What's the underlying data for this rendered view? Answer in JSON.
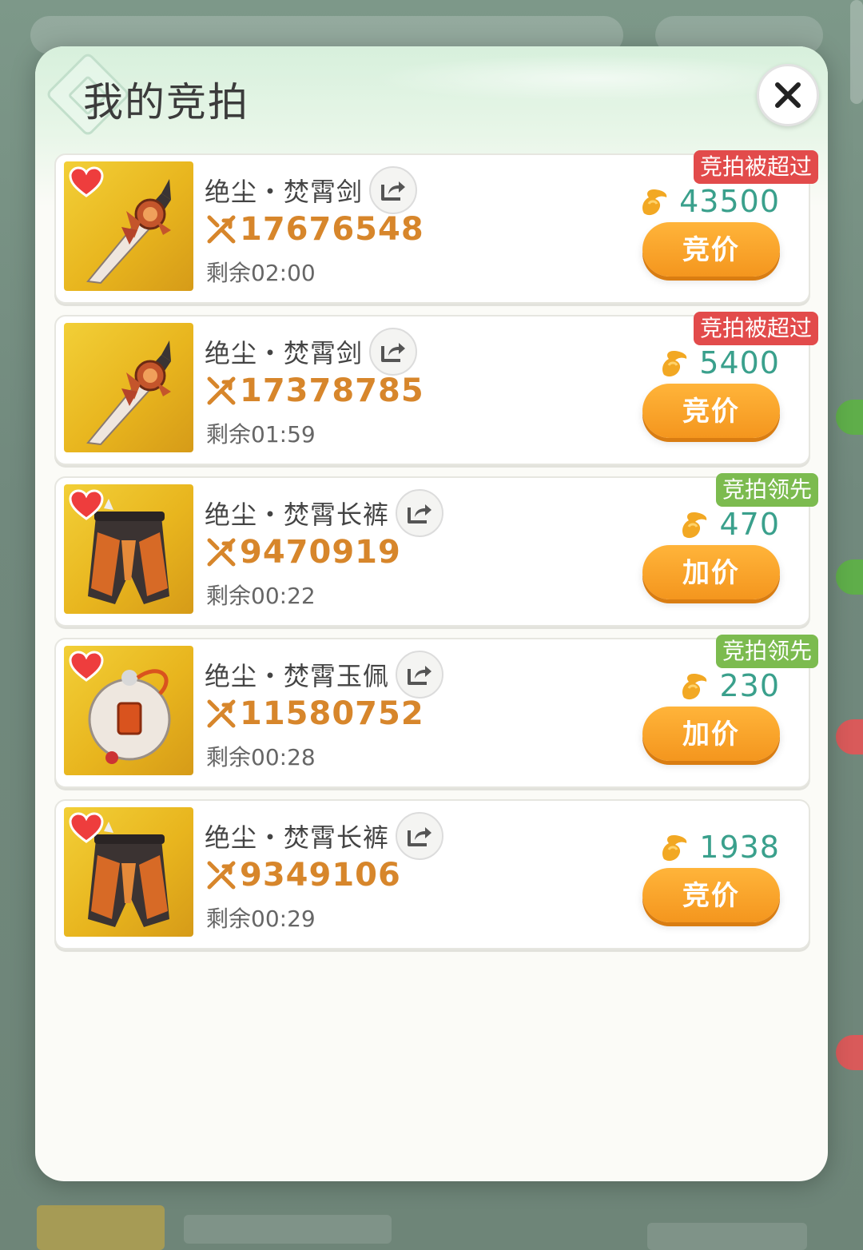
{
  "modal": {
    "title": "我的竞拍"
  },
  "items": [
    {
      "name": "绝尘・焚霄剑",
      "price": "17676548",
      "time_left": "剩余02:00",
      "status": "竞拍被超过",
      "status_color": "#e24b4b",
      "bid": "43500",
      "action": "竞价",
      "image": "sword",
      "favorited": true
    },
    {
      "name": "绝尘・焚霄剑",
      "price": "17378785",
      "time_left": "剩余01:59",
      "status": "竞拍被超过",
      "status_color": "#e24b4b",
      "bid": "5400",
      "action": "竞价",
      "image": "sword",
      "favorited": false
    },
    {
      "name": "绝尘・焚霄长裤",
      "price": "9470919",
      "time_left": "剩余00:22",
      "status": "竞拍领先",
      "status_color": "#7cbb4f",
      "bid": "470",
      "action": "加价",
      "image": "pants",
      "favorited": true
    },
    {
      "name": "绝尘・焚霄玉佩",
      "price": "11580752",
      "time_left": "剩余00:28",
      "status": "竞拍领先",
      "status_color": "#7cbb4f",
      "bid": "230",
      "action": "加价",
      "image": "pendant",
      "favorited": true
    },
    {
      "name": "绝尘・焚霄长裤",
      "price": "9349106",
      "time_left": "剩余00:29",
      "status": "",
      "status_color": "",
      "bid": "1938",
      "action": "竞价",
      "image": "pants",
      "favorited": true
    }
  ],
  "icons": {
    "close": "close-icon",
    "share": "share-icon",
    "coin": "coin-icon",
    "price": "price-tag-icon",
    "favorite": "heart-icon"
  },
  "colors": {
    "accent_orange": "#f4961e",
    "price_orange": "#d7862b",
    "bid_teal": "#3aa08c",
    "outbid_red": "#e24b4b",
    "leading_green": "#7cbb4f"
  }
}
